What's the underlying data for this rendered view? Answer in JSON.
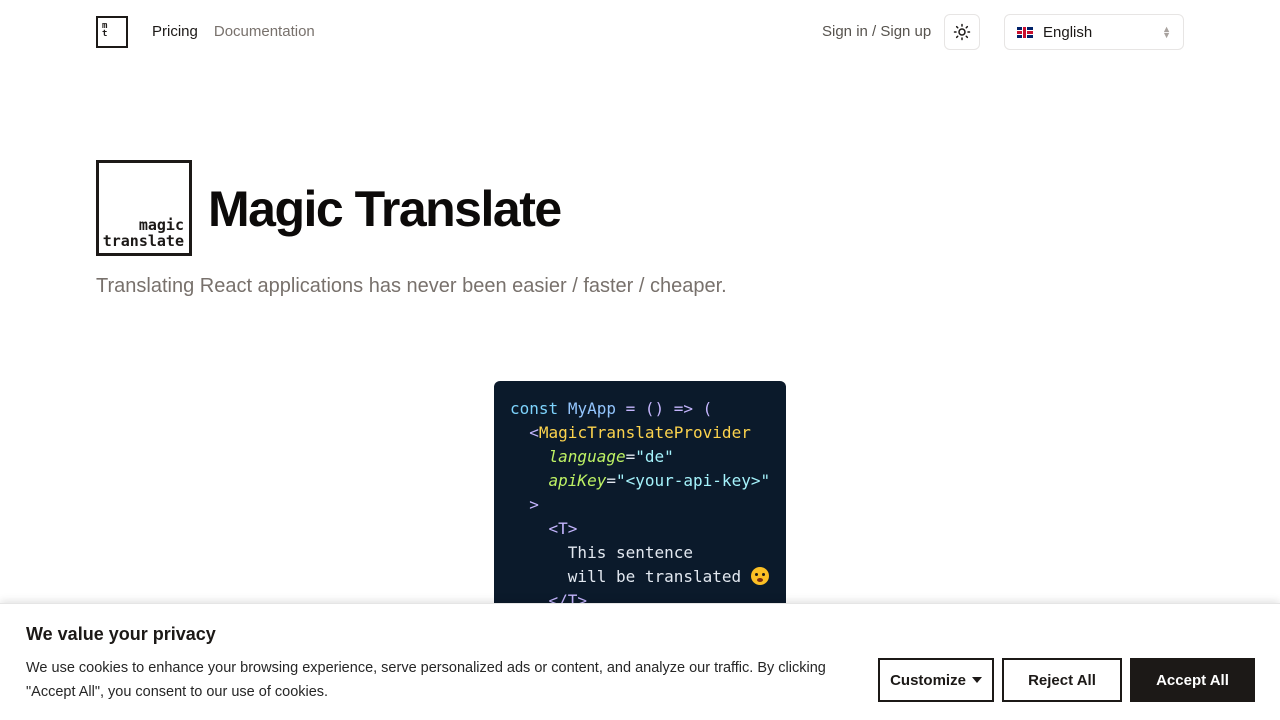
{
  "header": {
    "logo_small": {
      "line1": "m",
      "line2": "t"
    },
    "nav": [
      {
        "label": "Pricing"
      },
      {
        "label": "Documentation"
      }
    ],
    "signin_label": "Sign in / Sign up",
    "theme_icon": "sun-icon",
    "language": {
      "selected": "English",
      "flag_icon": "uk-flag-icon"
    }
  },
  "hero": {
    "logo_big": {
      "line1": "magic",
      "line2": "translate"
    },
    "title": "Magic Translate",
    "subtitle": "Translating React applications has never been easier / faster / cheaper."
  },
  "code": {
    "l1_kw": "const",
    "l1_name": "MyApp",
    "l1_rest": " = () => (",
    "l2_open": "<",
    "l2_tag": "MagicTranslateProvider",
    "l3_attr": "language",
    "l3_val": "\"de\"",
    "l4_attr": "apiKey",
    "l4_val": "\"<your-api-key>\"",
    "l5": ">",
    "l6_tag": "<T>",
    "l7": "This sentence",
    "l8": "will be translated",
    "l9_tag": "</T>"
  },
  "cookie": {
    "title": "We value your privacy",
    "text": "We use cookies to enhance your browsing experience, serve personalized ads or content, and analyze our traffic. By clicking \"Accept All\", you consent to our use of cookies.",
    "customize": "Customize",
    "reject": "Reject All",
    "accept": "Accept All"
  }
}
